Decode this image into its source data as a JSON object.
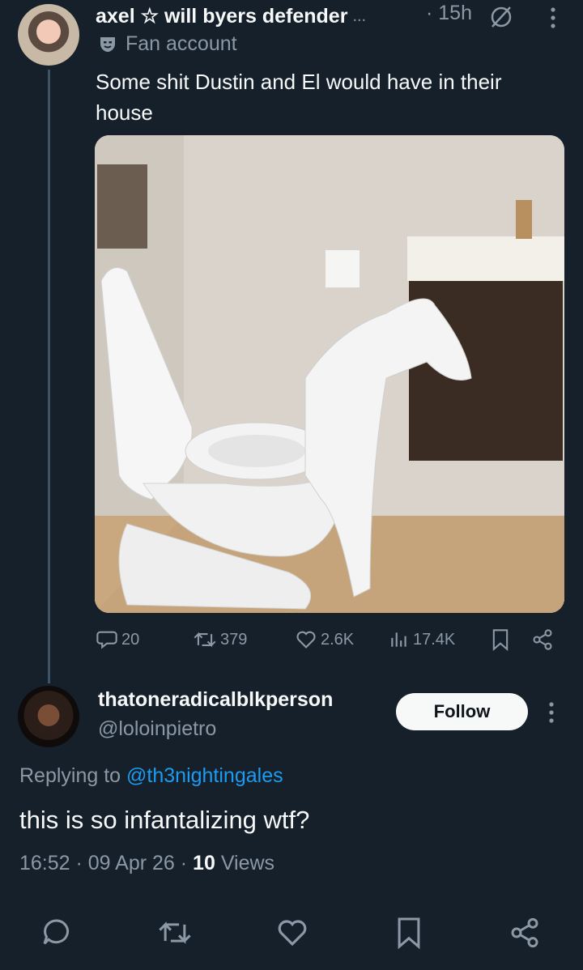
{
  "tweet": {
    "author_name": "axel ☆ will byers defender",
    "ellipsis": "...",
    "time": "· 15h",
    "label": "Fan account",
    "text": "Some shit Dustin and El would have in their house",
    "counts": {
      "replies": "20",
      "retweets": "379",
      "likes": "2.6K",
      "views": "17.4K"
    }
  },
  "reply": {
    "author_name": "thatoneradicalblkperson",
    "handle": "@loloinpietro",
    "follow_label": "Follow",
    "replying_prefix": "Replying to",
    "replying_mention": "@th3nightingales",
    "text": "this is so infantalizing wtf?",
    "meta_prefix": "16:52 · 09 Apr 26 ·",
    "views_count": "10",
    "views_label": "Views"
  },
  "icons": {
    "reply": "reply-icon",
    "retweet": "retweet-icon",
    "like": "heart-icon",
    "views": "views-icon",
    "bookmark": "bookmark-icon",
    "share": "share-icon",
    "more": "more-vertical-icon",
    "mute": "mute-icon",
    "fan": "mask-icon"
  },
  "colors": {
    "background": "#15202b",
    "text": "#f7f9f9",
    "muted": "#8b98a5",
    "accent": "#1d9bf0"
  }
}
